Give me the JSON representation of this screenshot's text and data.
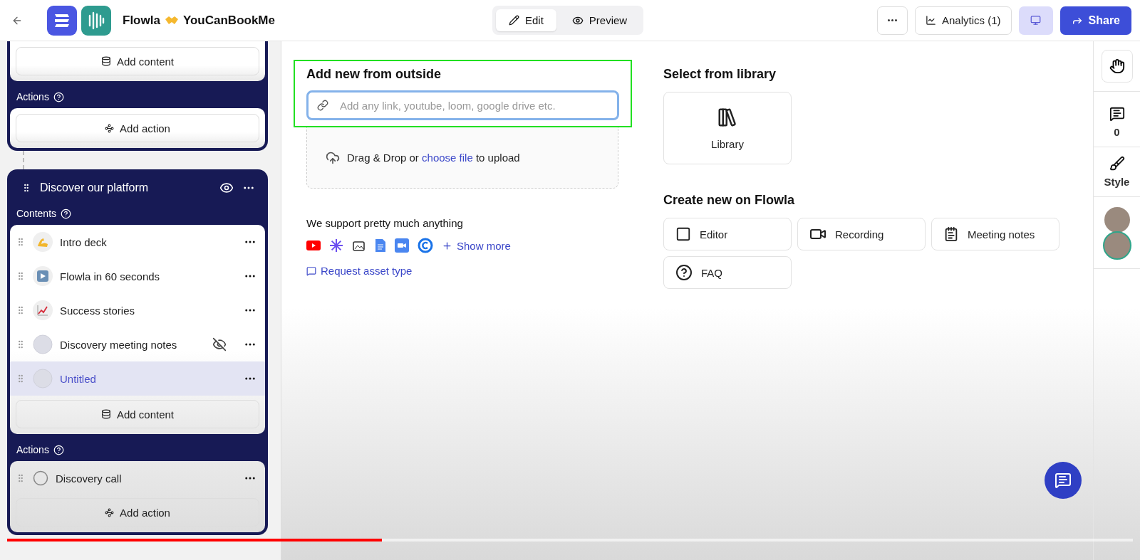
{
  "header": {
    "title_left": "Flowla",
    "title_right": "YouCanBookMe",
    "mode_tabs": [
      {
        "label": "Edit",
        "selected": true
      },
      {
        "label": "Preview",
        "selected": false
      }
    ],
    "analytics": "Analytics (1)",
    "share": "Share"
  },
  "sidebar": {
    "top_card": {
      "add_content": "Add content",
      "actions_label": "Actions",
      "add_action": "Add action"
    },
    "section": {
      "title": "Discover our platform",
      "contents_label": "Contents",
      "items": [
        {
          "label": "Intro deck",
          "kind": "muscle",
          "hidden": false,
          "selected": false
        },
        {
          "label": "Flowla in 60 seconds",
          "kind": "play",
          "hidden": false,
          "selected": false
        },
        {
          "label": "Success stories",
          "kind": "chart",
          "hidden": false,
          "selected": false
        },
        {
          "label": "Discovery meeting notes",
          "kind": "blank",
          "hidden": true,
          "selected": false
        },
        {
          "label": "Untitled",
          "kind": "blank",
          "hidden": false,
          "selected": true
        }
      ],
      "add_content": "Add content",
      "actions_label": "Actions",
      "actions": [
        {
          "label": "Discovery call"
        }
      ],
      "add_action": "Add action"
    }
  },
  "main": {
    "outside": {
      "title": "Add new from outside",
      "highlighted": true,
      "placeholder": "Add any link, youtube, loom, google drive etc.",
      "drop_before": "Drag & Drop or",
      "drop_link": "choose file",
      "drop_after": "to upload",
      "support_text": "We support pretty much anything",
      "show_more": "Show more",
      "request": "Request asset type"
    },
    "library": {
      "title": "Select from library",
      "card": "Library"
    },
    "create": {
      "title": "Create new on Flowla",
      "options": [
        {
          "label": "Editor",
          "kind": "editor"
        },
        {
          "label": "Recording",
          "kind": "recording"
        },
        {
          "label": "Meeting notes",
          "kind": "notes"
        },
        {
          "label": "FAQ",
          "kind": "faq"
        }
      ]
    }
  },
  "rail": {
    "comments": "0",
    "style": "Style"
  },
  "video_progress": {
    "level": 0.333
  }
}
